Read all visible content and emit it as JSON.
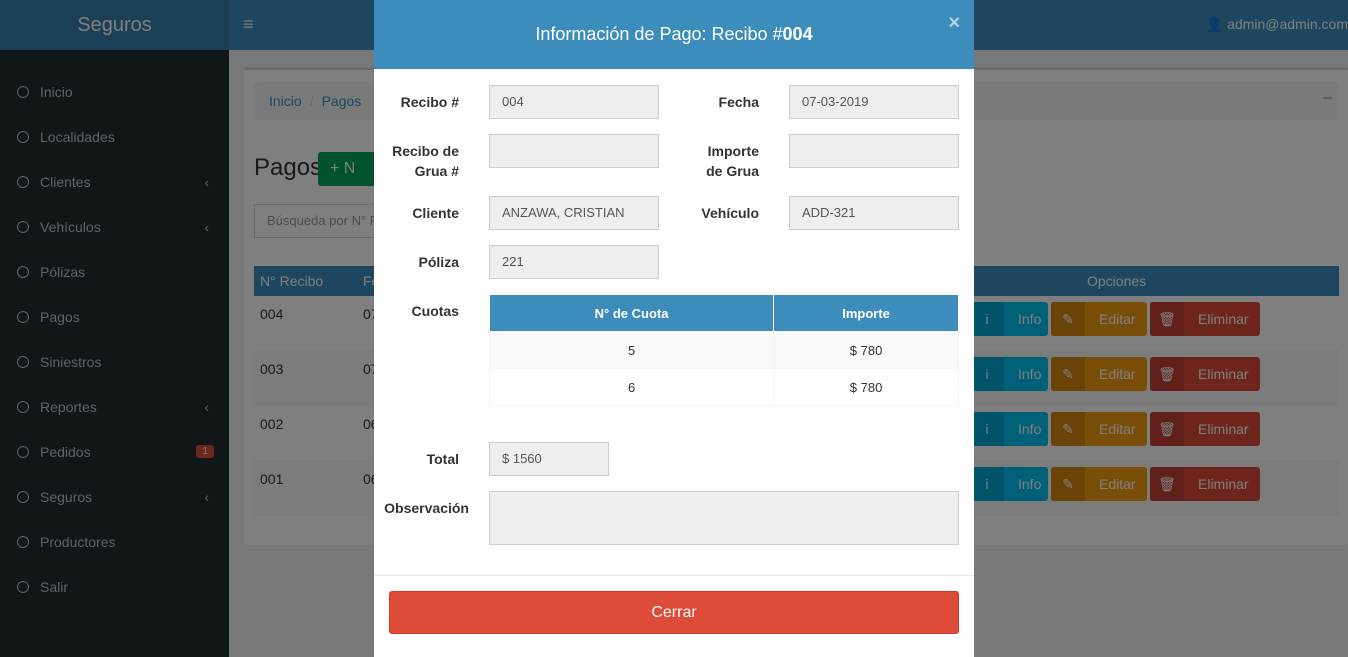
{
  "header": {
    "brand": "Seguros",
    "toggle_icon": "≡",
    "user": "👤 admin@admin.com"
  },
  "sidebar": {
    "items": [
      {
        "label": "Inicio"
      },
      {
        "label": "Localidades"
      },
      {
        "label": "Clientes",
        "chevron": "‹"
      },
      {
        "label": "Vehículos",
        "chevron": "‹"
      },
      {
        "label": "Pólizas"
      },
      {
        "label": "Pagos"
      },
      {
        "label": "Siniestros"
      },
      {
        "label": "Reportes",
        "chevron": "‹"
      },
      {
        "label": "Pedidos",
        "badge": "1"
      },
      {
        "label": "Seguros",
        "chevron": "‹"
      },
      {
        "label": "Productores"
      },
      {
        "label": "Salir"
      }
    ]
  },
  "page": {
    "breadcrumb": [
      "Inicio",
      "Pagos"
    ],
    "collapse_icon": "−",
    "title": "Pagos",
    "add_button": "+  N",
    "search_placeholder": "Búsqueda por N° R",
    "table_headers": {
      "recibo": "N° Recibo",
      "fecha": "Fe",
      "opciones": "Opciones"
    },
    "rows": [
      {
        "recibo": "004",
        "fecha": "07"
      },
      {
        "recibo": "003",
        "fecha": "07"
      },
      {
        "recibo": "002",
        "fecha": "06"
      },
      {
        "recibo": "001",
        "fecha": "06"
      }
    ],
    "buttons": {
      "info": "Info",
      "edit": "Editar",
      "delete": "Eliminar",
      "info_icon": "i",
      "edit_icon": "✎",
      "delete_icon": "🗑"
    }
  },
  "modal": {
    "title_prefix": "Información de Pago: Recibo #",
    "title_number": "004",
    "close_icon": "×",
    "labels": {
      "recibo": "Recibo #",
      "fecha": "Fecha",
      "grua_recibo": "Recibo de Grua #",
      "grua_importe": "Importe de Grua",
      "cliente": "Cliente",
      "vehiculo": "Vehículo",
      "poliza": "Póliza",
      "cuotas": "Cuotas",
      "total": "Total",
      "observacion": "Observación"
    },
    "values": {
      "recibo": "004",
      "fecha": "07-03-2019",
      "grua_recibo": "",
      "grua_importe": "",
      "cliente": "ANZAWA, CRISTIAN",
      "vehiculo": "ADD-321",
      "poliza": "221",
      "total": "$ 1560",
      "observacion": ""
    },
    "cuotas_headers": [
      "N° de Cuota",
      "Importe"
    ],
    "cuotas_rows": [
      {
        "cuota": "5",
        "importe": "$ 780"
      },
      {
        "cuota": "6",
        "importe": "$ 780"
      }
    ],
    "close_button": "Cerrar"
  }
}
